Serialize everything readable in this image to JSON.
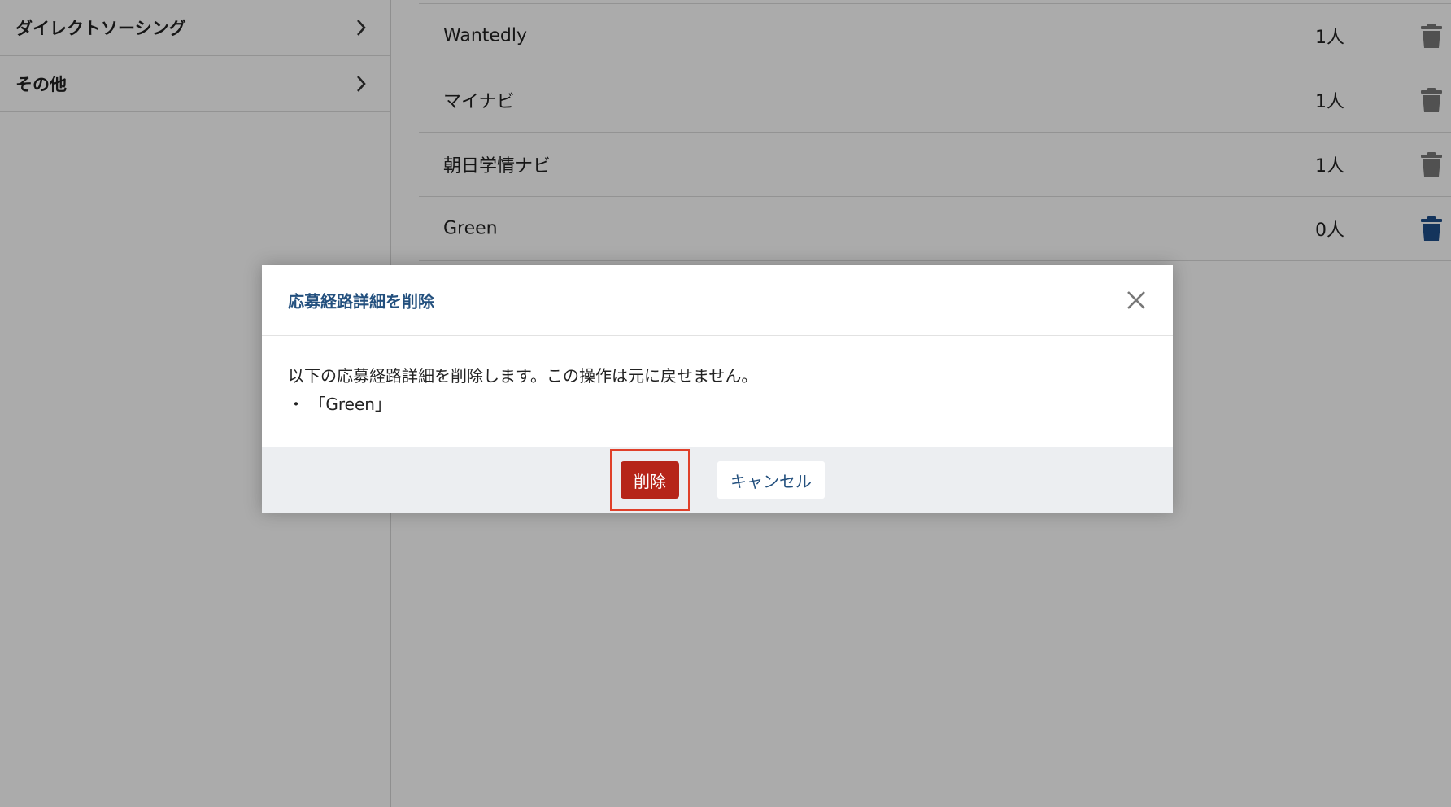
{
  "sidebar": {
    "items": [
      {
        "label": "ダイレクトソーシング"
      },
      {
        "label": "その他"
      }
    ]
  },
  "sources": {
    "rows": [
      {
        "name": "Wantedly",
        "count": "1人",
        "trash_color": "#7a7a7a"
      },
      {
        "name": "マイナビ",
        "count": "1人",
        "trash_color": "#7a7a7a"
      },
      {
        "name": "朝日学情ナビ",
        "count": "1人",
        "trash_color": "#7a7a7a"
      },
      {
        "name": "Green",
        "count": "0人",
        "trash_color": "#1f4e8a"
      }
    ]
  },
  "modal": {
    "title": "応募経路詳細を削除",
    "message": "以下の応募経路詳細を削除します。この操作は元に戻せません。",
    "item": "・ 「Green」",
    "delete_label": "削除",
    "cancel_label": "キャンセル"
  },
  "colors": {
    "accent": "#23507e",
    "danger": "#b62519",
    "highlight_border": "#e0402a"
  }
}
